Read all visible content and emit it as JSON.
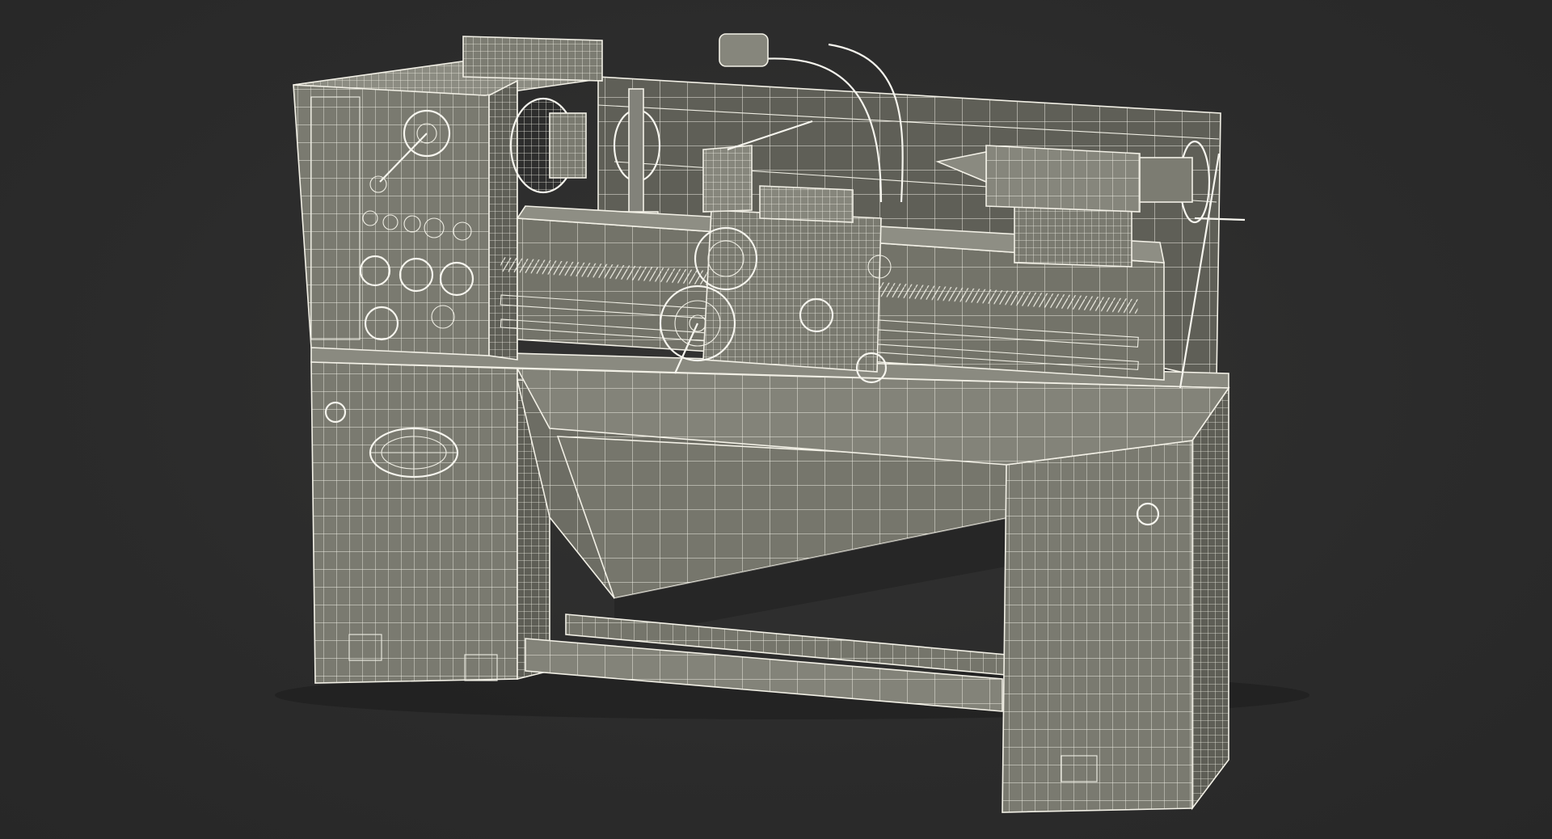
{
  "scene": {
    "subject": "lathe-wireframe-render",
    "colors": {
      "background": "#2a2a2a",
      "body_fill": "#6b6b62",
      "body_fill_light": "#7a7a70",
      "body_fill_dark": "#55554d",
      "wire": "#f2f0e6",
      "shadow": "#1e1e1c"
    }
  }
}
